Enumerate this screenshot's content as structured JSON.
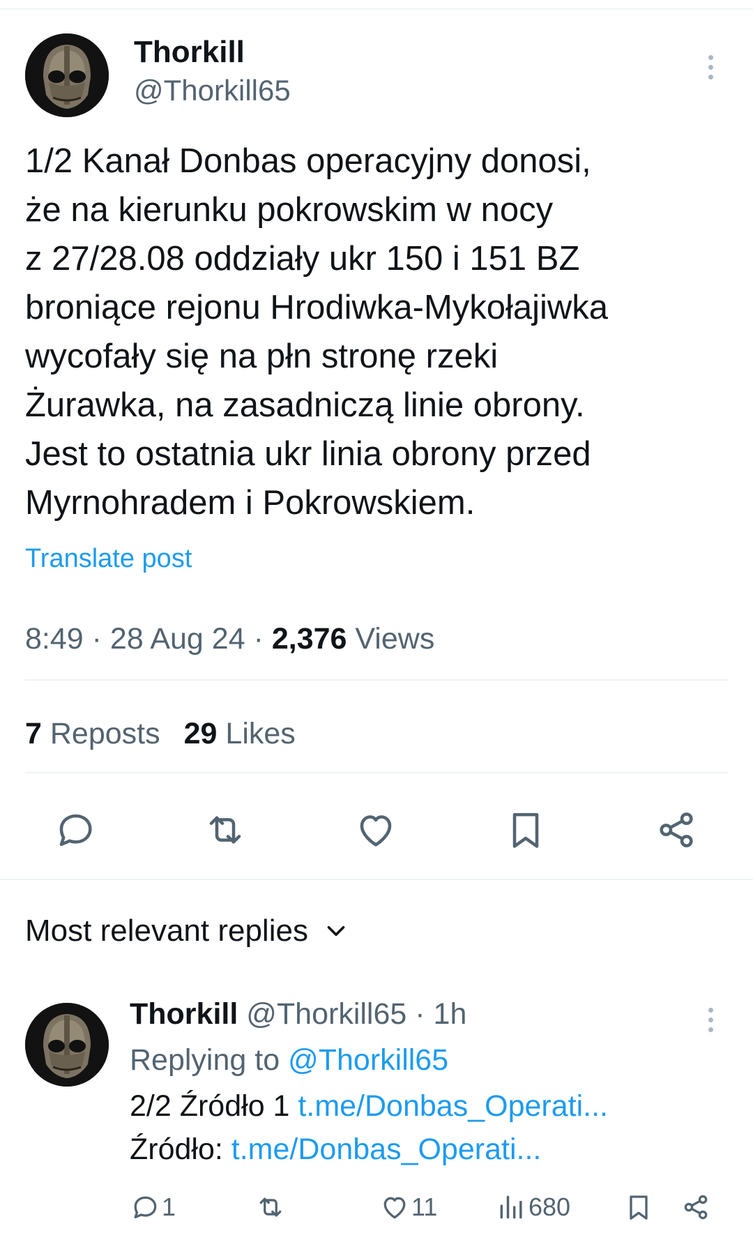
{
  "tweet": {
    "author_name": "Thorkill",
    "author_handle": "@Thorkill65",
    "avatar_icon": "helmet-avatar",
    "body": "1/2 Kanał Donbas operacyjny donosi,\nże na kierunku pokrowskim w nocy\nz 27/28.08 oddziały ukr 150 i 151 BZ\nbroniące rejonu Hrodiwka-Mykołajiwka\nwycofały się na płn stronę rzeki\nŻurawka, na zasadniczą linie obrony.\nJest to ostatnia ukr linia obrony przed\nMyrnohradem i Pokrowskiem.",
    "translate_label": "Translate post",
    "time": "8:49",
    "separator": " · ",
    "date": "28 Aug 24",
    "views_count": "2,376",
    "views_label": " Views",
    "reposts_count": "7",
    "reposts_label": " Reposts",
    "likes_count": "29",
    "likes_label": " Likes"
  },
  "actions": [
    "reply-icon",
    "repost-icon",
    "like-icon",
    "bookmark-icon",
    "share-icon"
  ],
  "replies_section": {
    "title": "Most relevant replies"
  },
  "reply": {
    "author_name": "Thorkill",
    "author_handle": "@Thorkill65",
    "time": " · 1h",
    "replying_prefix": "Replying to ",
    "replying_handle": "@Thorkill65",
    "line1_prefix": "2/2 Źródło 1 ",
    "line1_link": "t.me/Donbas_Operati...",
    "line2_prefix": "Źródło: ",
    "line2_link": "t.me/Donbas_Operati...",
    "reply_count": "1",
    "like_count": "11",
    "view_count": "680"
  },
  "colors": {
    "accent": "#1d9bf0",
    "muted": "#536471",
    "text": "#0f1419",
    "divider": "#eff3f4"
  }
}
